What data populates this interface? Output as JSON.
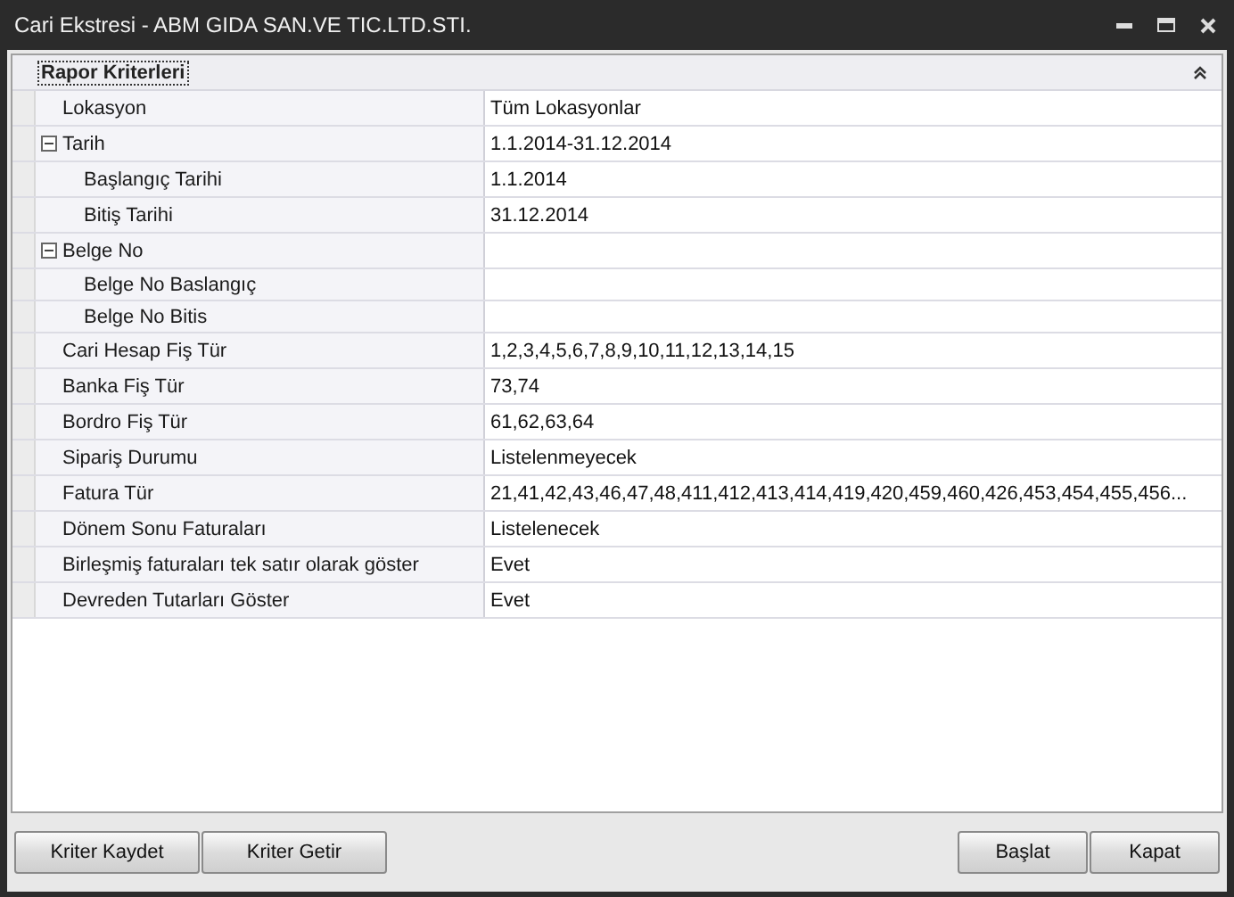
{
  "window": {
    "title": "Cari Ekstresi - ABM GIDA SAN.VE TIC.LTD.STI."
  },
  "category": {
    "label": "Rapor Kriterleri",
    "expanded": true
  },
  "rows": [
    {
      "name": "Lokasyon",
      "value": "Tüm Lokasyonlar"
    },
    {
      "name": "Tarih",
      "value": "1.1.2014-31.12.2014",
      "expanded": true,
      "children": [
        {
          "name": "Başlangıç Tarihi",
          "value": "1.1.2014"
        },
        {
          "name": "Bitiş Tarihi",
          "value": "31.12.2014"
        }
      ]
    },
    {
      "name": "Belge No",
      "expanded": true,
      "children": [
        {
          "name": "Belge No Baslangıç"
        },
        {
          "name": "Belge No Bitis"
        }
      ]
    },
    {
      "name": "Cari Hesap Fiş Tür",
      "value": "1,2,3,4,5,6,7,8,9,10,11,12,13,14,15"
    },
    {
      "name": "Banka Fiş Tür",
      "value": "73,74"
    },
    {
      "name": "Bordro Fiş Tür",
      "value": "61,62,63,64"
    },
    {
      "name": "Sipariş Durumu",
      "value": "Listelenmeyecek"
    },
    {
      "name": "Fatura Tür",
      "value": "21,41,42,43,46,47,48,411,412,413,414,419,420,459,460,426,453,454,455,456..."
    },
    {
      "name": "Dönem Sonu Faturaları",
      "value": "Listelenecek"
    },
    {
      "name": "Birleşmiş faturaları tek satır olarak göster",
      "value": "Evet"
    },
    {
      "name": "Devreden Tutarları Göster",
      "value": "Evet"
    }
  ],
  "buttons_left": [
    "Kriter Kaydet",
    "Kriter Getir"
  ],
  "buttons_right": [
    "Başlat",
    "Kapat"
  ]
}
